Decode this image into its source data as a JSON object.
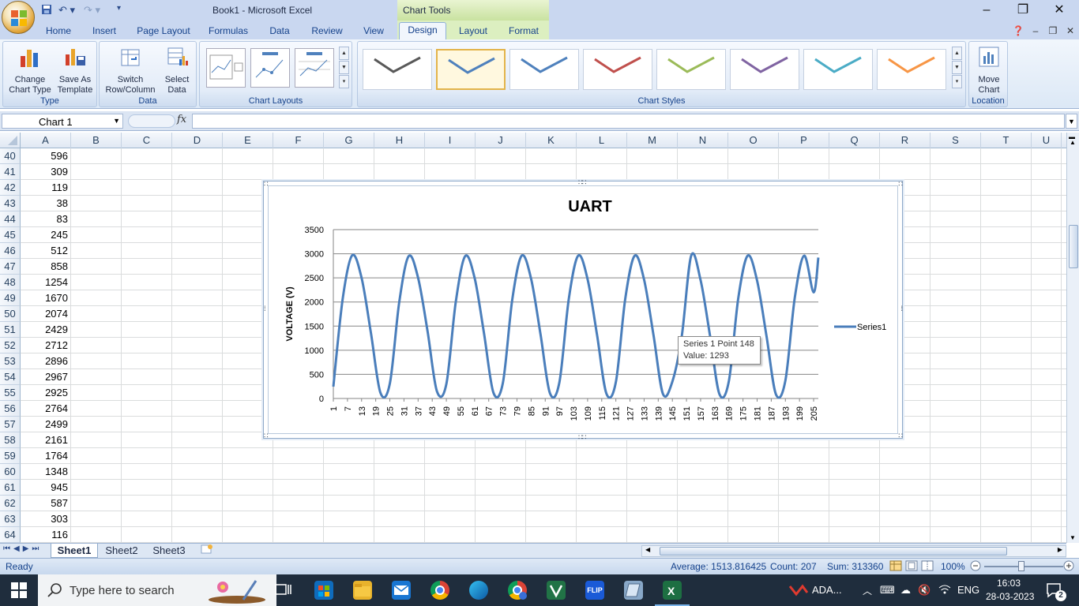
{
  "window": {
    "title": "Book1 - Microsoft Excel",
    "context_title": "Chart Tools"
  },
  "ribbon": {
    "tabs": [
      "Home",
      "Insert",
      "Page Layout",
      "Formulas",
      "Data",
      "Review",
      "View",
      "Design",
      "Layout",
      "Format"
    ],
    "active_tab": "Design",
    "groups": {
      "type": {
        "label": "Type",
        "change_chart_type": [
          "Change",
          "Chart Type"
        ],
        "save_as_template": [
          "Save As",
          "Template"
        ]
      },
      "data": {
        "label": "Data",
        "switch_row_column": [
          "Switch",
          "Row/Column"
        ],
        "select_data": [
          "Select",
          "Data"
        ]
      },
      "chart_layouts": {
        "label": "Chart Layouts"
      },
      "chart_styles": {
        "label": "Chart Styles",
        "swatches": [
          "#595959",
          "#4f81bd",
          "#4f81bd",
          "#c0504d",
          "#9bbb59",
          "#8064a2",
          "#4bacc6",
          "#f79646"
        ]
      },
      "location": {
        "label": "Location",
        "move_chart": [
          "Move",
          "Chart"
        ]
      }
    }
  },
  "formula_bar": {
    "name_box": "Chart 1",
    "fx": "fx",
    "formula": ""
  },
  "grid": {
    "columns": [
      "A",
      "B",
      "C",
      "D",
      "E",
      "F",
      "G",
      "H",
      "I",
      "J",
      "K",
      "L",
      "M",
      "N",
      "O",
      "P",
      "Q",
      "R",
      "S",
      "T",
      "U"
    ],
    "rows": [
      {
        "n": "40",
        "a": "596"
      },
      {
        "n": "41",
        "a": "309"
      },
      {
        "n": "42",
        "a": "119"
      },
      {
        "n": "43",
        "a": "38"
      },
      {
        "n": "44",
        "a": "83"
      },
      {
        "n": "45",
        "a": "245"
      },
      {
        "n": "46",
        "a": "512"
      },
      {
        "n": "47",
        "a": "858"
      },
      {
        "n": "48",
        "a": "1254"
      },
      {
        "n": "49",
        "a": "1670"
      },
      {
        "n": "50",
        "a": "2074"
      },
      {
        "n": "51",
        "a": "2429"
      },
      {
        "n": "52",
        "a": "2712"
      },
      {
        "n": "53",
        "a": "2896"
      },
      {
        "n": "54",
        "a": "2967"
      },
      {
        "n": "55",
        "a": "2925"
      },
      {
        "n": "56",
        "a": "2764"
      },
      {
        "n": "57",
        "a": "2499"
      },
      {
        "n": "58",
        "a": "2161"
      },
      {
        "n": "59",
        "a": "1764"
      },
      {
        "n": "60",
        "a": "1348"
      },
      {
        "n": "61",
        "a": "945"
      },
      {
        "n": "62",
        "a": "587"
      },
      {
        "n": "63",
        "a": "303"
      },
      {
        "n": "64",
        "a": "116"
      }
    ]
  },
  "chart_data": {
    "type": "line",
    "title": "UART",
    "ylabel": "VOLTAGE (V)",
    "xlabel": "",
    "ylim": [
      0,
      3500
    ],
    "yticks": [
      0,
      500,
      1000,
      1500,
      2000,
      2500,
      3000,
      3500
    ],
    "xtick_labels": [
      "1",
      "7",
      "13",
      "19",
      "25",
      "31",
      "37",
      "43",
      "49",
      "55",
      "61",
      "67",
      "73",
      "79",
      "85",
      "91",
      "97",
      "103",
      "109",
      "115",
      "121",
      "127",
      "133",
      "139",
      "145",
      "151",
      "157",
      "163",
      "169",
      "175",
      "181",
      "187",
      "193",
      "199",
      "205"
    ],
    "grid": true,
    "legend": "right",
    "series": [
      {
        "name": "Series1",
        "color": "#4a7ebb",
        "x": [
          1,
          5,
          9,
          13,
          17,
          21,
          25,
          29,
          33,
          37,
          41,
          45,
          49,
          53,
          57,
          61,
          65,
          69,
          73,
          77,
          81,
          85,
          89,
          93,
          97,
          101,
          105,
          109,
          113,
          117,
          121,
          125,
          129,
          133,
          137,
          141,
          145,
          149,
          153,
          157,
          161,
          165,
          169,
          173,
          177,
          181,
          185,
          189,
          193,
          197,
          201,
          205,
          207
        ],
        "values": [
          245,
          2074,
          2967,
          2499,
          1348,
          119,
          310,
          2000,
          2950,
          2500,
          1400,
          150,
          300,
          2000,
          2950,
          2500,
          1350,
          120,
          320,
          2050,
          2960,
          2480,
          1330,
          110,
          330,
          2060,
          2960,
          2470,
          1320,
          100,
          340,
          2070,
          2960,
          2460,
          1310,
          95,
          350,
          1293,
          2960,
          2450,
          1300,
          90,
          360,
          2080,
          2960,
          2440,
          1290,
          85,
          370,
          2090,
          2960,
          2200,
          2920
        ]
      }
    ]
  },
  "tooltip": {
    "line1": "Series 1 Point 148",
    "line2": "Value: 1293"
  },
  "sheets": [
    "Sheet1",
    "Sheet2",
    "Sheet3"
  ],
  "active_sheet": "Sheet1",
  "status": {
    "mode": "Ready",
    "average": "Average: 1513.816425",
    "count": "Count: 207",
    "sum": "Sum: 313360",
    "zoom": "100%"
  },
  "taskbar": {
    "search_placeholder": "Type here to search",
    "tray_app": "ADA...",
    "lang": "ENG",
    "time": "16:03",
    "date": "28-03-2023",
    "notifications": "2"
  }
}
